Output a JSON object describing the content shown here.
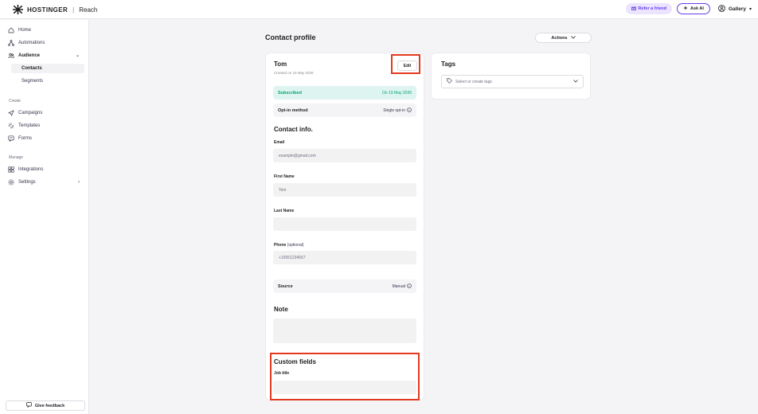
{
  "brand": {
    "name": "HOSTINGER",
    "separator": "|",
    "product": "Reach"
  },
  "topbar": {
    "refer_label": "Refer a friend",
    "ask_label": "Ask AI",
    "account_label": "Gallery"
  },
  "sidebar": {
    "home": "Home",
    "automations": "Automations",
    "audience": "Audience",
    "contacts": "Contacts",
    "segments": "Segments",
    "create_section": "Create",
    "campaigns": "Campaigns",
    "templates": "Templates",
    "forms": "Forms",
    "manage_section": "Manage",
    "integrations": "Integrations",
    "settings": "Settings",
    "feedback": "Give feedback"
  },
  "page": {
    "title": "Contact profile",
    "actions_label": "Actions"
  },
  "contact": {
    "name": "Tom",
    "created": "Created on 19 May 2026",
    "edit_label": "Edit",
    "status_label": "Subscribed",
    "status_date": "On 19 May 2026",
    "optin_label": "Opt-in method",
    "optin_value": "Single opt-in",
    "contact_info_title": "Contact info.",
    "email_label": "Email",
    "email_value": "example@gmail.com",
    "first_name_label": "First Name",
    "first_name_value": "Tom",
    "last_name_label": "Last Name",
    "last_name_value": "",
    "phone_label": "Phone",
    "phone_optional": "(optional)",
    "phone_value": "+15551234567",
    "source_label": "Source",
    "source_value": "Manual",
    "note_title": "Note",
    "custom_fields_title": "Custom fields",
    "job_title_label": "Job title",
    "job_title_value": ""
  },
  "tags": {
    "title": "Tags",
    "placeholder": "Select or create tags"
  },
  "colors": {
    "accent": "#673de6",
    "success": "#00a86b",
    "highlight": "#e5391f"
  }
}
